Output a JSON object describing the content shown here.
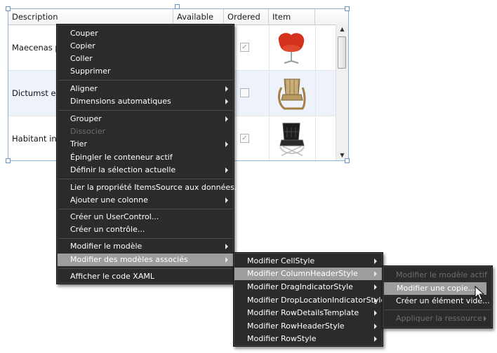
{
  "grid": {
    "columns": [
      "Description",
      "Available",
      "Ordered",
      "Item"
    ],
    "rows": [
      {
        "description": "Maecenas p",
        "ordered": true,
        "item_icon": "swan-chair-red"
      },
      {
        "description": "Dictumst el",
        "ordered": false,
        "item_icon": "armchair-wood"
      },
      {
        "description": "Habitant inc",
        "ordered": true,
        "item_icon": "barcelona-chair-black"
      }
    ]
  },
  "context_menu": {
    "items": [
      {
        "label": "Couper"
      },
      {
        "label": "Copier"
      },
      {
        "label": "Coller"
      },
      {
        "label": "Supprimer"
      },
      {
        "label": "Aligner",
        "submenu": true
      },
      {
        "label": "Dimensions automatiques",
        "submenu": true
      },
      {
        "label": "Grouper",
        "submenu": true
      },
      {
        "label": "Dissocier",
        "disabled": true
      },
      {
        "label": "Trier",
        "submenu": true
      },
      {
        "label": "Épingler le conteneur actif"
      },
      {
        "label": "Définir la sélection actuelle",
        "submenu": true
      },
      {
        "label": "Lier la propriété ItemsSource aux données..."
      },
      {
        "label": "Ajouter une colonne",
        "submenu": true
      },
      {
        "label": "Créer un UserControl..."
      },
      {
        "label": "Créer un contrôle..."
      },
      {
        "label": "Modifier le modèle",
        "submenu": true
      },
      {
        "label": "Modifier des modèles associés",
        "submenu": true,
        "highlighted": true
      },
      {
        "label": "Afficher le code XAML"
      }
    ]
  },
  "submenu_templates": {
    "items": [
      {
        "label": "Modifier CellStyle",
        "submenu": true
      },
      {
        "label": "Modifier ColumnHeaderStyle",
        "submenu": true,
        "highlighted": true
      },
      {
        "label": "Modifier DragIndicatorStyle",
        "submenu": true
      },
      {
        "label": "Modifier DropLocationIndicatorStyle",
        "submenu": true
      },
      {
        "label": "Modifier RowDetailsTemplate",
        "submenu": true
      },
      {
        "label": "Modifier RowHeaderStyle",
        "submenu": true
      },
      {
        "label": "Modifier RowStyle",
        "submenu": true
      }
    ]
  },
  "submenu_style": {
    "items": [
      {
        "label": "Modifier le modèle actif",
        "disabled": true
      },
      {
        "label": "Modifier une copie...",
        "highlighted": true
      },
      {
        "label": "Créer un élément vide..."
      },
      {
        "label": "Appliquer la ressource",
        "disabled": true,
        "submenu": true
      }
    ]
  },
  "colors": {
    "menu_bg": "#2b2b2b",
    "highlight": "#9d9d9d",
    "selection_border": "#8fb0d6",
    "row_alt": "#eef3fb"
  }
}
